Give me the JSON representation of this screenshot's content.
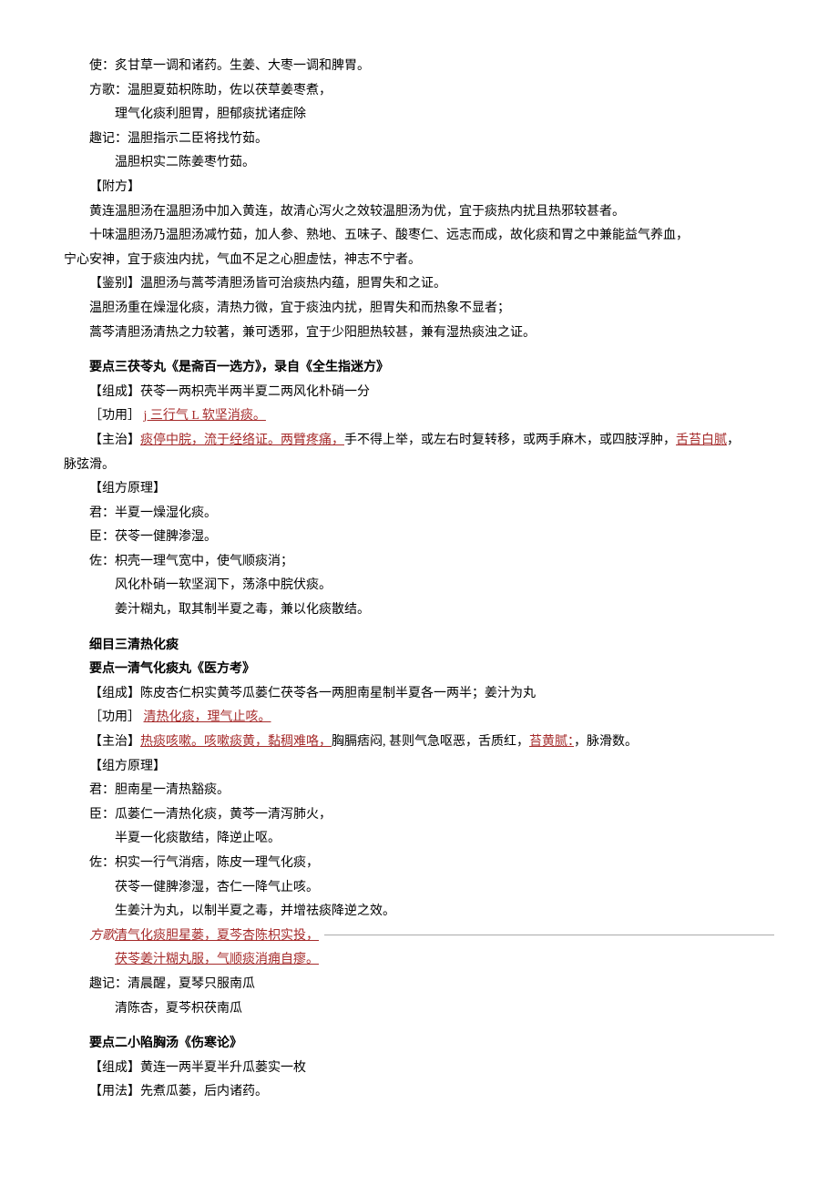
{
  "part1": {
    "l1": "使：炙甘草一调和诸药。生姜、大枣一调和脾胃。",
    "l2": "方歌：温胆夏茹枳陈助，佐以茯草姜枣煮，",
    "l3": "理气化痰利胆胃，胆郁痰扰诸症除",
    "l4": "趣记：温胆指示二臣将找竹茹。",
    "l5": "温胆枳实二陈姜枣竹茹。",
    "l6": "【附方】",
    "l7": "黄连温胆汤在温胆汤中加入黄连，故清心泻火之效较温胆汤为优，宜于痰热内扰且热邪较甚者。",
    "l8": "十味温胆汤乃温胆汤减竹茹，加人参、熟地、五味子、酸枣仁、远志而成，故化痰和胃之中兼能益气养血，",
    "l9": "宁心安神，宜于痰浊内扰，气血不足之心胆虚怯，神志不宁者。",
    "l10": "【鉴别】温胆汤与蒿芩清胆汤皆可治痰热内蕴，胆胃失和之证。",
    "l11": "温胆汤重在燥湿化痰，清热力微，宜于痰浊内扰，胆胃失和而热象不显者；",
    "l12": "蒿芩清胆汤清热之力较著，兼可透邪，宜于少阳胆热较甚，兼有湿热痰浊之证。"
  },
  "section2": {
    "title": "要点三茯苓丸《是斋百一选方》，录自《全生指迷方》",
    "zucheng": "【组成】茯苓一两枳壳半两半夏二两风化朴硝一分",
    "gongyong_label": "［功用］",
    "gongyong_link": "j 三行气 L 软坚消",
    "gongyong_tail": "痰。",
    "zhuzhi_label": "【主治】",
    "zhuzhi_link1": "痰停中脘，流于经络证。两臂疼痛，",
    "zhuzhi_mid": "手不得上举，或左右时复转移，或两手麻木，或四肢浮肿，",
    "zhuzhi_link2": "舌苔白腻",
    "zhuzhi_tail": "，",
    "zhuzhi_line2": "脉弦滑。",
    "yuanli": "【组方原理】",
    "jun": "君：半夏一燥湿化痰。",
    "chen": "臣：茯苓一健脾渗湿。",
    "zuo1": "佐：枳壳一理气宽中，使气顺痰消；",
    "zuo2": "风化朴硝一软坚润下，荡涤中脘伏痰。",
    "zuo3": "姜汁糊丸，取其制半夏之毒，兼以化痰散结。"
  },
  "section3": {
    "subtitle": "细目三清热化痰",
    "title": "要点一清气化痰丸《医方考》",
    "zucheng": "【组成】陈皮杏仁枳实黄芩瓜蒌仁茯苓各一两胆南星制半夏各一两半；姜汁为丸",
    "gongyong_label": "［功用］",
    "gongyong_link": "清热化痰，理气止咳。",
    "zhuzhi_label": "【主治】",
    "zhuzhi_link1": "热痰咳嗽。咳嗽痰黄，黏稠难咯，",
    "zhuzhi_mid": "胸膈痞闷, 甚则气急呕恶，舌质红，",
    "zhuzhi_link2": "苔黄腻：",
    "zhuzhi_tail": "，脉滑数。",
    "yuanli": "【组方原理】",
    "jun": "君：胆南星一清热豁痰。",
    "chen1": "臣：瓜蒌仁一清热化痰，黄芩一清泻肺火，",
    "chen2": "半夏一化痰散结，降逆止呕。",
    "zuo1": "佐：枳实一行气消痞，陈皮一理气化痰，",
    "zuo2": "茯苓一健脾渗湿，杏仁一降气止咳。",
    "zuo3": "生姜汁为丸，以制半夏之毒，并增祛痰降逆之效。",
    "fangge_label": "方歌",
    "fangge_link1": "清气化痰胆星蒌，夏芩杏陈枳实投，",
    "fangge_link2": "茯苓姜汁糊丸服，气顺痰消痈自瘳。",
    "quji1": "趣记：清晨醒，夏琴只服南瓜",
    "quji2": "清陈杏，夏芩枳茯南瓜"
  },
  "section4": {
    "title": "要点二小陷胸汤《伤寒论》",
    "zucheng": "【组成】黄连一两半夏半升瓜蒌实一枚",
    "yongfa": "【用法】先煮瓜蒌，后内诸药。"
  }
}
